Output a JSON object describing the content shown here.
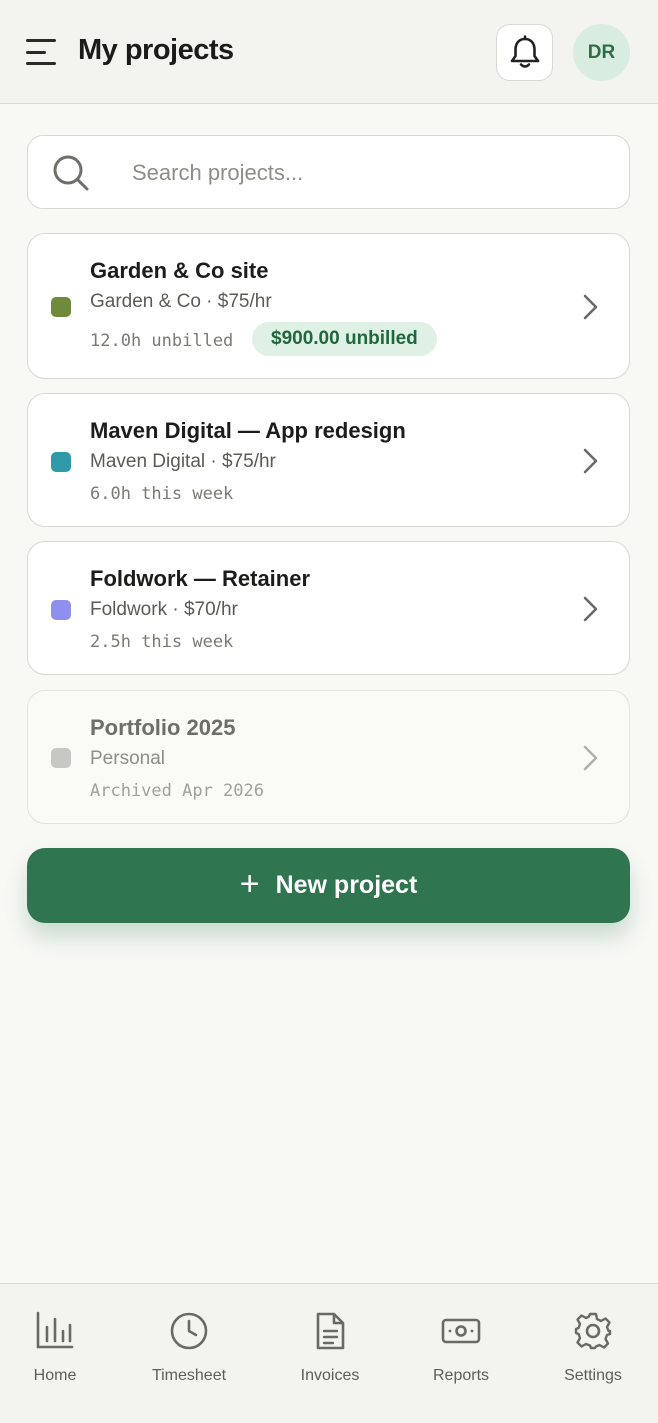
{
  "header": {
    "title": "My projects",
    "avatar_initials": "DR",
    "menu_icon": "hamburger-menu-icon",
    "bell_icon": "bell-icon"
  },
  "search": {
    "placeholder": "Search projects...",
    "value": ""
  },
  "projects": [
    {
      "name": "Garden & Co site",
      "meta": "Garden & Co · $75/hr",
      "hours": "12.0h unbilled",
      "badge": "$900.00 unbilled",
      "color": "#6e8a3a",
      "archived": false
    },
    {
      "name": "Maven Digital — App redesign",
      "meta": "Maven Digital · $75/hr",
      "hours": "6.0h this week",
      "color": "#2f9aa7",
      "archived": false
    },
    {
      "name": "Foldwork — Retainer",
      "meta": "Foldwork · $70/hr",
      "hours": "2.5h this week",
      "color": "#8f8ff0",
      "archived": false
    },
    {
      "name": "Portfolio 2025",
      "meta": "Personal",
      "hours": "Archived Apr 2026",
      "color": "#c8c8c3",
      "archived": true
    }
  ],
  "new_project": {
    "label": "New project"
  },
  "nav": [
    {
      "label": "Home",
      "icon": "bar-chart-icon"
    },
    {
      "label": "Timesheet",
      "icon": "clock-icon"
    },
    {
      "label": "Invoices",
      "icon": "document-icon"
    },
    {
      "label": "Reports",
      "icon": "banknote-icon"
    },
    {
      "label": "Settings",
      "icon": "gear-icon"
    }
  ],
  "colors": {
    "accent": "#2f7550",
    "badge_bg": "#dff0e4",
    "badge_text": "#22663f",
    "avatar_bg": "#d9ece0"
  }
}
